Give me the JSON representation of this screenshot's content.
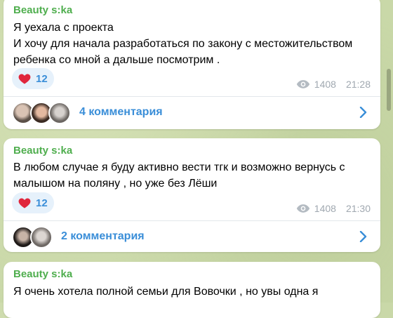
{
  "posts": [
    {
      "author": "Beauty s:ka",
      "lines": [
        "Я уехала с проекта",
        "И хочу для начала разработаться по закону с местожительством",
        "ребенка со мной а дальше посмотрим ."
      ],
      "reaction": {
        "icon": "heart-icon",
        "count": "12"
      },
      "views": "1408",
      "time": "21:28",
      "comments": "4 комментария"
    },
    {
      "author": "Beauty s:ka",
      "lines": [
        "В любом случае я буду активно вести тгк и возможно вернусь с",
        "малышом на поляну , но уже без Лёши"
      ],
      "reaction": {
        "icon": "heart-icon",
        "count": "12"
      },
      "views": "1408",
      "time": "21:30",
      "comments": "2 комментария"
    },
    {
      "author": "Beauty s:ka",
      "lines": [
        "Я очень хотела полной семьи для Вовочки , но увы одна я"
      ]
    }
  ],
  "colors": {
    "author": "#4fae4e",
    "link": "#3a8ed8",
    "reaction_bg": "#e6f1fb",
    "heart": "#e0263c",
    "meta": "#a0a8b0",
    "background": "#c9d8a8"
  }
}
